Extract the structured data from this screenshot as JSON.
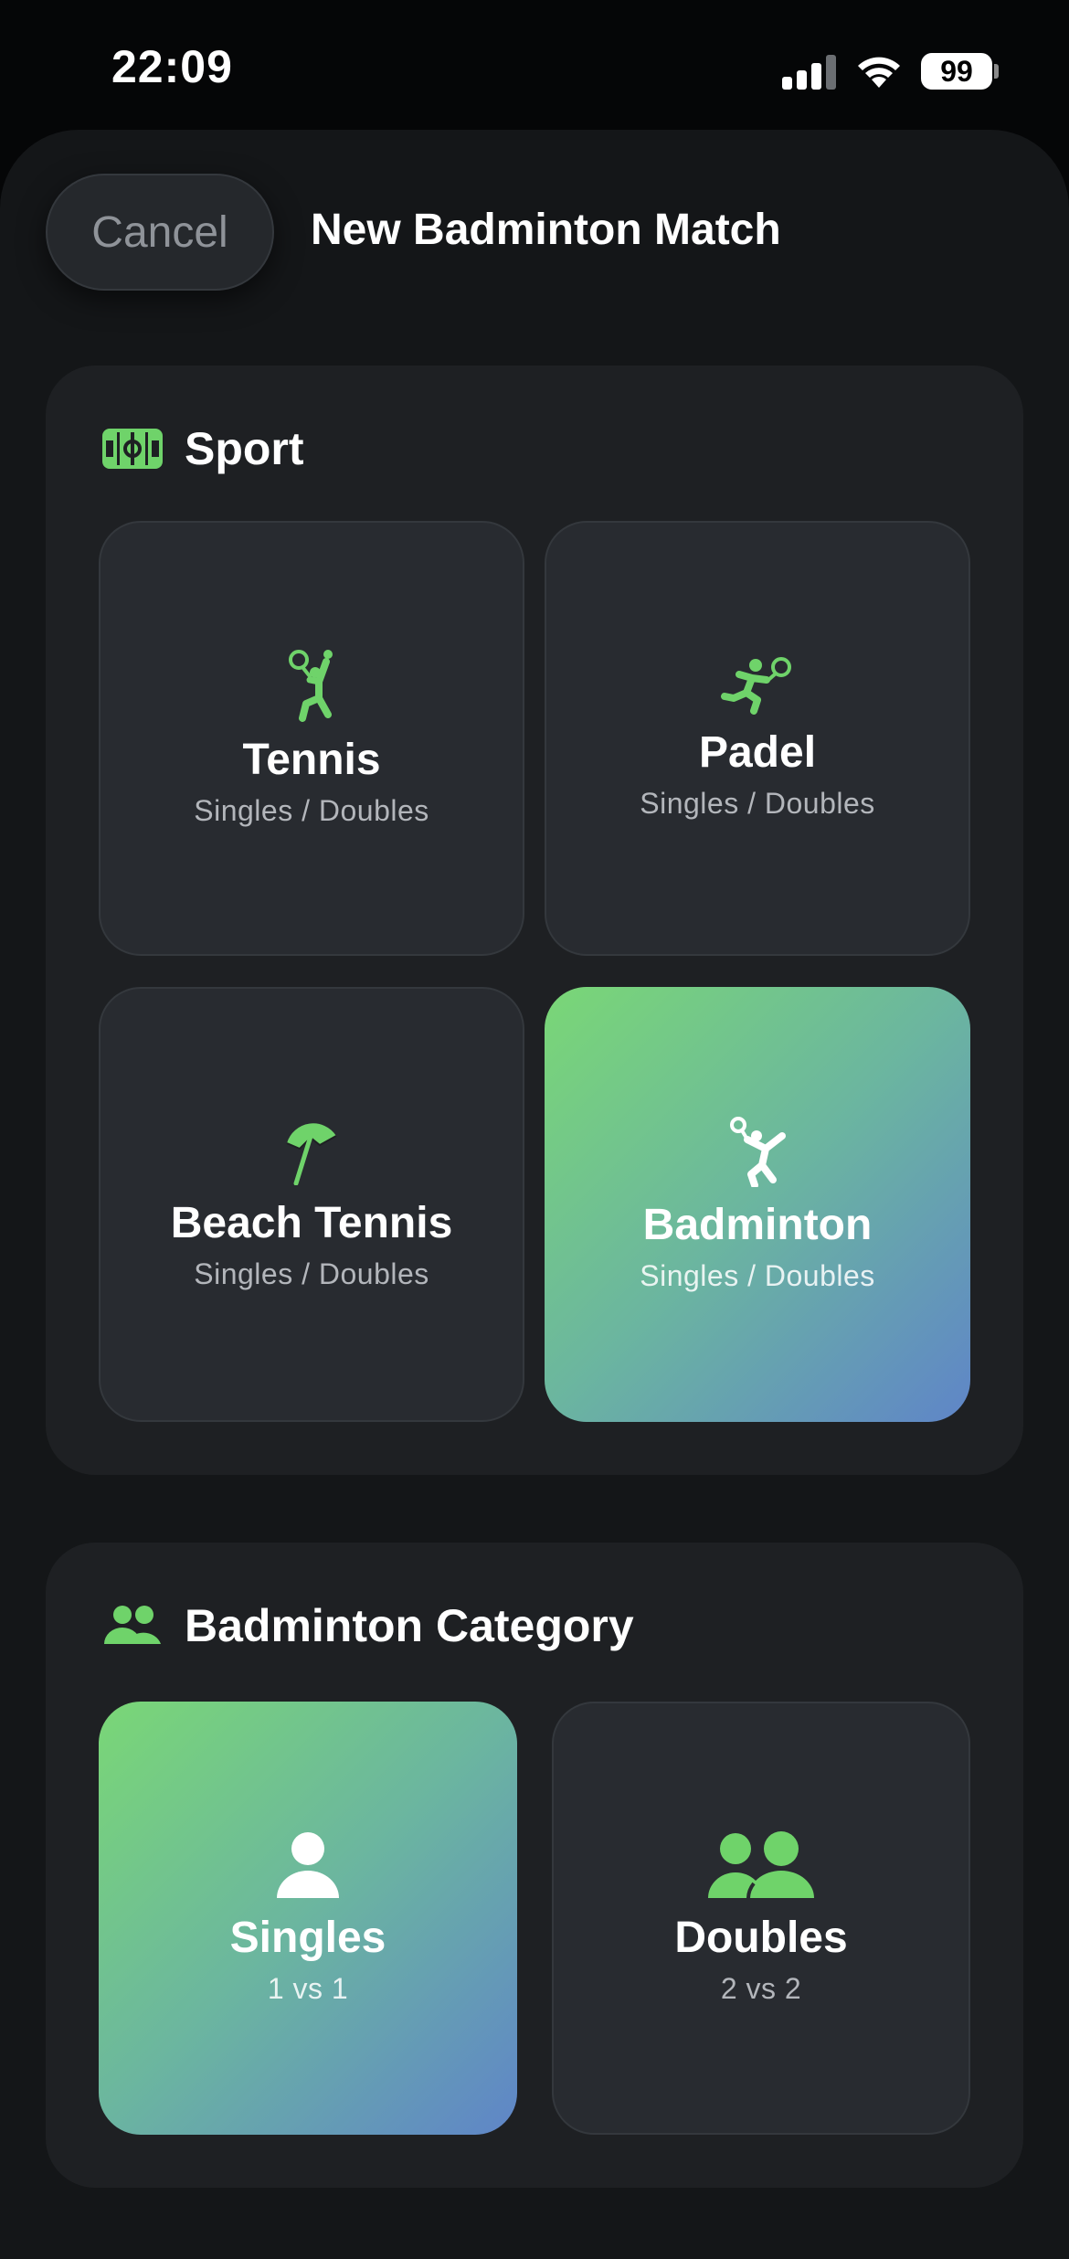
{
  "status_bar": {
    "time": "22:09",
    "battery": "99"
  },
  "header": {
    "cancel_label": "Cancel",
    "title": "New Badminton Match"
  },
  "sport_section": {
    "title": "Sport",
    "icon": "court-icon",
    "tiles": [
      {
        "title": "Tennis",
        "subtitle": "Singles / Doubles",
        "icon": "tennis-player-icon",
        "selected": false
      },
      {
        "title": "Padel",
        "subtitle": "Singles / Doubles",
        "icon": "padel-player-icon",
        "selected": false
      },
      {
        "title": "Beach Tennis",
        "subtitle": "Singles / Doubles",
        "icon": "beach-umbrella-icon",
        "selected": false
      },
      {
        "title": "Badminton",
        "subtitle": "Singles / Doubles",
        "icon": "badminton-player-icon",
        "selected": true
      }
    ]
  },
  "category_section": {
    "title": "Badminton Category",
    "icon": "people-icon",
    "tiles": [
      {
        "title": "Singles",
        "subtitle": "1 vs 1",
        "icon": "person-icon",
        "selected": true
      },
      {
        "title": "Doubles",
        "subtitle": "2 vs 2",
        "icon": "two-people-icon",
        "selected": false
      }
    ]
  },
  "colors": {
    "accent_green": "#6fd36a",
    "gradient_start": "#7ad776",
    "gradient_end": "#5f85c8",
    "background": "#141618",
    "card": "#1e2023",
    "tile": "#282b30"
  }
}
